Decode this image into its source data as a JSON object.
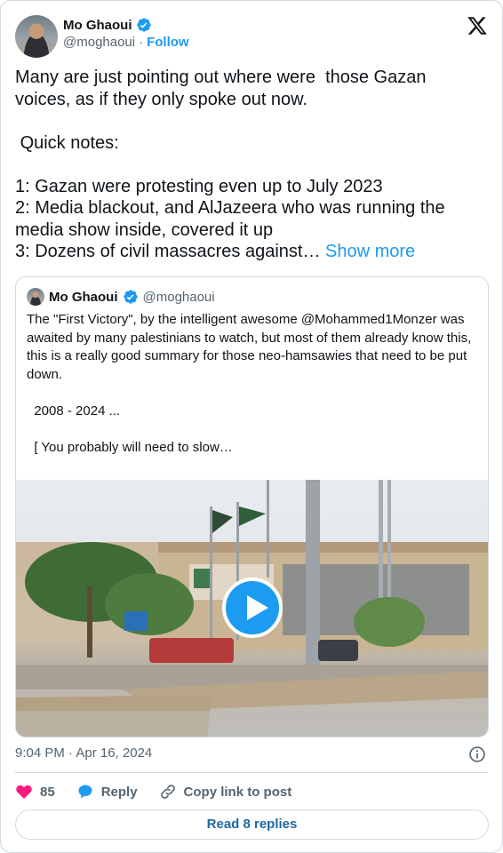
{
  "author": {
    "name": "Mo Ghaoui",
    "handle": "@moghaoui",
    "separator": "·",
    "follow_label": "Follow"
  },
  "tweet": {
    "text": "Many are just pointing out where were  those Gazan voices, as if they only spoke out now.\n\n Quick notes:\n\n1: Gazan were protesting even up to July 2023\n2: Media blackout, and AlJazeera who was running the media show inside, covered it up\n3: Dozens of civil massacres against… ",
    "show_more_label": "Show more"
  },
  "quoted": {
    "name": "Mo Ghaoui",
    "handle": "@moghaoui",
    "text": "The \"First Victory\", by the intelligent awesome @Mohammed1Monzer was awaited by many palestinians to watch, but most of them already know this, this is a really good summary for those neo-hamsawies that need to be put down.\n\n  2008 - 2024 ...\n\n  [ You probably will need to slow…"
  },
  "meta": {
    "timestamp": "9:04 PM · Apr 16, 2024"
  },
  "actions": {
    "like_count": "85",
    "reply_label": "Reply",
    "copy_label": "Copy link to post"
  },
  "read_replies_label": "Read 8 replies",
  "colors": {
    "accent": "#1d9bf0",
    "like": "#f91880",
    "text": "#0f1419",
    "muted": "#536471",
    "border": "#cfd9de"
  },
  "icons": [
    "verified-icon",
    "x-logo-icon",
    "play-icon",
    "info-icon",
    "heart-icon",
    "reply-icon",
    "link-icon"
  ]
}
